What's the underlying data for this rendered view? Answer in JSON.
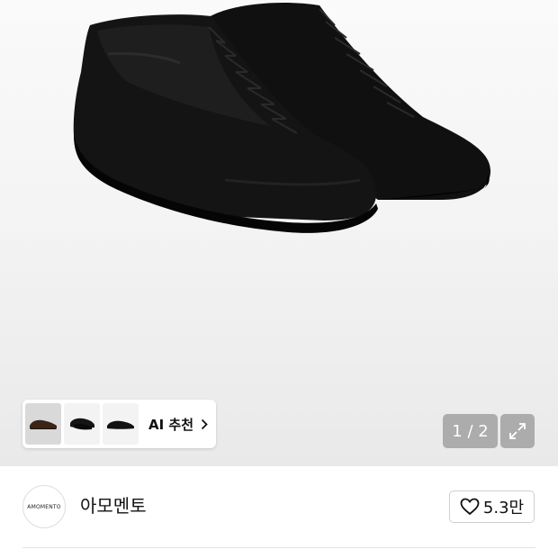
{
  "gallery": {
    "thumbnails": [
      {
        "icon": "brown-shoe-thumbnail",
        "active": true
      },
      {
        "icon": "black-shoe-thumbnail-1",
        "active": false
      },
      {
        "icon": "black-shoe-thumbnail-2",
        "active": false
      }
    ],
    "ai_recommend_label": "AI 추천",
    "page_current": "1",
    "page_separator": " / ",
    "page_total": "2"
  },
  "brand": {
    "logo_text": "AMOMENTO",
    "name": "아모멘토",
    "like_count": "5.3만"
  },
  "colors": {
    "text": "#111111",
    "overlay": "#787878",
    "shoe": "#0c0c0c"
  }
}
